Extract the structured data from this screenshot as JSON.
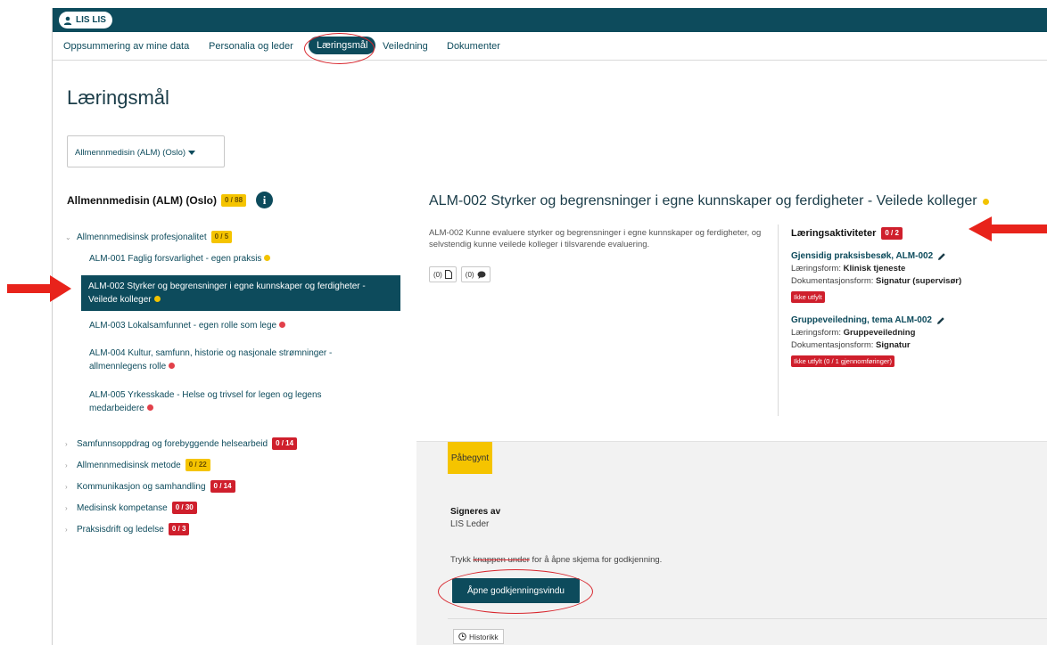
{
  "user": {
    "name": "LIS LIS"
  },
  "nav": {
    "items": [
      "Oppsummering av mine data",
      "Personalia og leder",
      "Læringsmål",
      "Veiledning",
      "Dokumenter"
    ],
    "active": "Læringsmål"
  },
  "page": {
    "title": "Læringsmål",
    "dropdown_value": "Allmennmedisin (ALM) (Oslo)"
  },
  "left": {
    "heading": "Allmennmedisin (ALM) (Oslo)",
    "heading_badge": "0 / 88",
    "expanded_group": {
      "label": "Allmennmedisinsk profesjonalitet",
      "badge": "0 / 5"
    },
    "goals": [
      {
        "text": "ALM-001 Faglig forsvarlighet - egen praksis",
        "status": "yellow"
      },
      {
        "text": "ALM-002 Styrker og begrensninger i egne kunnskaper og ferdigheter - Veilede kolleger",
        "status": "yellow",
        "selected": true
      },
      {
        "text": "ALM-003 Lokalsamfunnet - egen rolle som lege",
        "status": "red"
      },
      {
        "text": "ALM-004 Kultur, samfunn, historie og nasjonale strømninger - allmennlegens rolle",
        "status": "red"
      },
      {
        "text": "ALM-005 Yrkesskade - Helse og trivsel for legen og legens medarbeidere",
        "status": "red"
      }
    ],
    "groups": [
      {
        "label": "Samfunnsoppdrag og forebyggende helsearbeid",
        "badge": "0 / 14",
        "color": "red"
      },
      {
        "label": "Allmennmedisinsk metode",
        "badge": "0 / 22",
        "color": "yellow"
      },
      {
        "label": "Kommunikasjon og samhandling",
        "badge": "0 / 14",
        "color": "red"
      },
      {
        "label": "Medisinsk kompetanse",
        "badge": "0 / 30",
        "color": "red"
      },
      {
        "label": "Praksisdrift og ledelse",
        "badge": "0 / 3",
        "color": "red"
      }
    ]
  },
  "detail": {
    "title": "ALM-002 Styrker og begrensninger i egne kunnskaper og ferdigheter - Veilede kolleger",
    "description": "ALM-002 Kunne evaluere styrker og begrensninger i egne kunnskaper og ferdigheter, og selvstendig kunne veilede kolleger i tilsvarende evaluering.",
    "docs_count": "(0)",
    "comments_count": "(0)",
    "activities_heading": "Læringsaktiviteter",
    "activities_badge": "0 / 2",
    "activities": [
      {
        "title": "Gjensidig praksisbesøk, ALM-002",
        "form_label": "Læringsform:",
        "form_value": "Klinisk tjeneste",
        "doc_label": "Dokumentasjonsform:",
        "doc_value": "Signatur (supervisør)",
        "status": "Ikke utfylt"
      },
      {
        "title": "Gruppeveiledning, tema ALM-002",
        "form_label": "Læringsform:",
        "form_value": "Gruppeveiledning",
        "doc_label": "Dokumentasjonsform:",
        "doc_value": "Signatur",
        "status": "Ikke utfylt (0 / 1 gjennomføringer)"
      }
    ]
  },
  "approval": {
    "status": "Påbegynt",
    "signed_by_label": "Signeres av",
    "signed_by_value": "LIS Leder",
    "instruction_pre": "Trykk ",
    "instruction_strike": "knappen under",
    "instruction_post": " for å åpne skjema for godkjenning.",
    "open_button": "Åpne godkjenningsvindu",
    "history_button": "Historikk"
  },
  "colors": {
    "primary": "#0d4b5c",
    "warning": "#f5c400",
    "danger": "#cf1f2c",
    "annotation": "#e8231b"
  }
}
